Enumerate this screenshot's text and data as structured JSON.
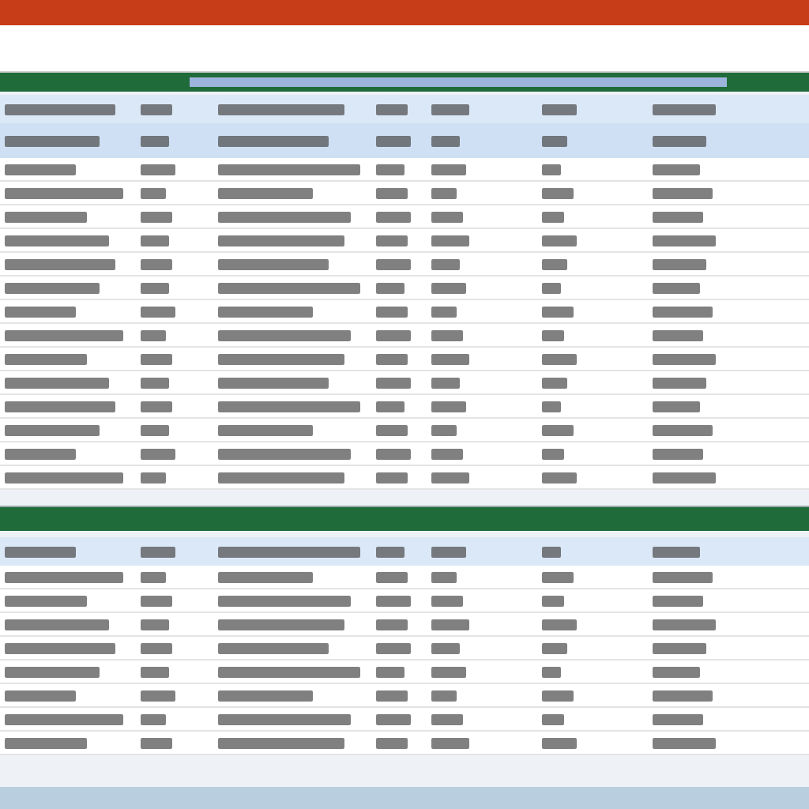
{
  "sheets": [
    {
      "rows": [
        {
          "kind": "header"
        },
        {
          "kind": "selected"
        },
        {
          "kind": "data"
        },
        {
          "kind": "data"
        },
        {
          "kind": "data"
        },
        {
          "kind": "data"
        },
        {
          "kind": "data"
        },
        {
          "kind": "data"
        },
        {
          "kind": "data"
        },
        {
          "kind": "data"
        },
        {
          "kind": "data"
        },
        {
          "kind": "data"
        },
        {
          "kind": "data"
        },
        {
          "kind": "data"
        },
        {
          "kind": "data"
        },
        {
          "kind": "data"
        }
      ]
    },
    {
      "rows": [
        {
          "kind": "header"
        },
        {
          "kind": "data"
        },
        {
          "kind": "data"
        },
        {
          "kind": "data"
        },
        {
          "kind": "data"
        },
        {
          "kind": "data"
        },
        {
          "kind": "data"
        },
        {
          "kind": "data"
        },
        {
          "kind": "data"
        }
      ]
    }
  ]
}
